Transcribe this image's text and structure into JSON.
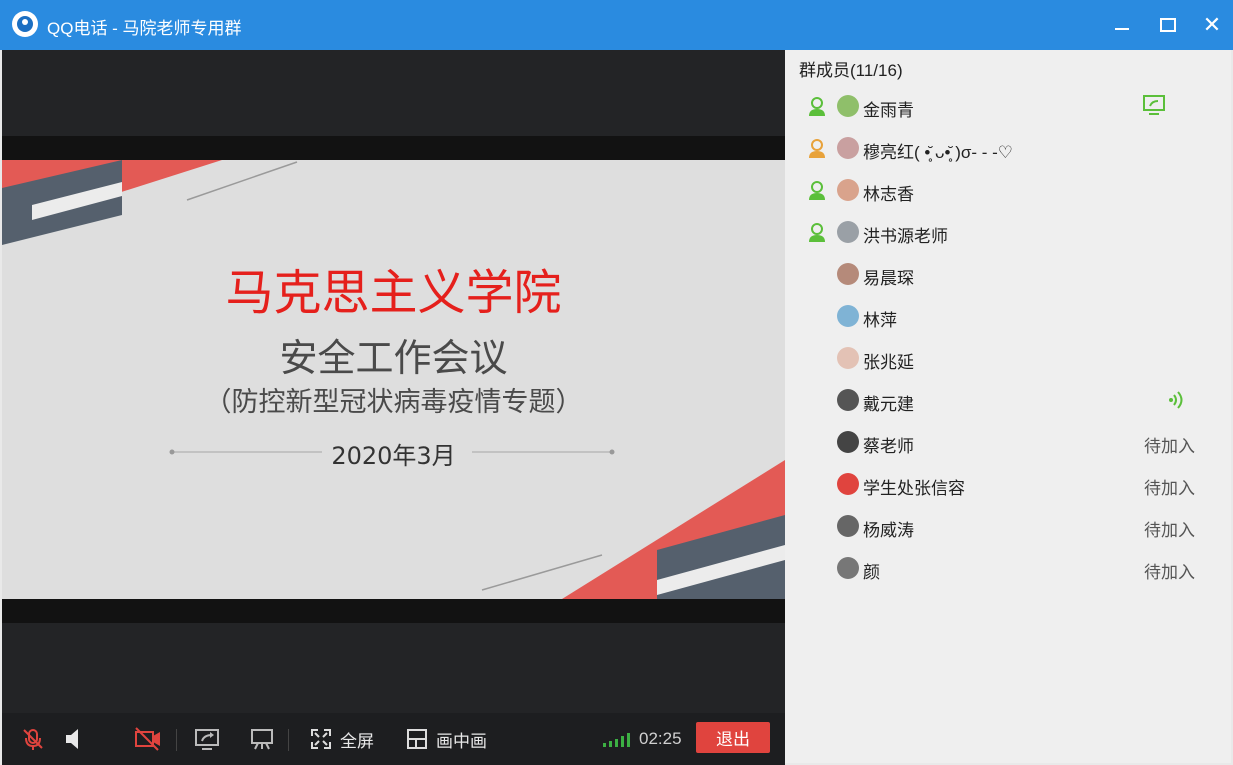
{
  "window": {
    "title": "QQ电话 - 马院老师专用群"
  },
  "slide": {
    "title": "马克思主义学院",
    "subtitle": "安全工作会议",
    "topic": "（防控新型冠状病毒疫情专题）",
    "date": "2020年3月"
  },
  "toolbar": {
    "fullscreen_label": "全屏",
    "pip_label": "画中画",
    "call_time": "02:25",
    "exit_label": "退出"
  },
  "panel": {
    "header": "群成员(11/16)",
    "members": [
      {
        "name": "金雨青",
        "status": "",
        "role": "green-user-icon",
        "extra": "screen-share-icon"
      },
      {
        "name": "穆亮红( •̥̆ ᴗ•̥̆ )σ- - -♡",
        "status": "",
        "role": "orange-user-icon",
        "extra": ""
      },
      {
        "name": "林志香",
        "status": "",
        "role": "green-user-icon",
        "extra": ""
      },
      {
        "name": "洪书源老师",
        "status": "",
        "role": "green-user-icon",
        "extra": ""
      },
      {
        "name": "易晨琛",
        "status": "",
        "role": "",
        "extra": ""
      },
      {
        "name": "林萍",
        "status": "",
        "role": "",
        "extra": ""
      },
      {
        "name": "张兆延",
        "status": "",
        "role": "",
        "extra": ""
      },
      {
        "name": "戴元建",
        "status": "",
        "role": "",
        "extra": "speaking-icon"
      },
      {
        "name": "蔡老师",
        "status": "待加入",
        "role": "",
        "extra": ""
      },
      {
        "name": "学生处张信容",
        "status": "待加入",
        "role": "",
        "extra": ""
      },
      {
        "name": "杨威涛",
        "status": "待加入",
        "role": "",
        "extra": ""
      },
      {
        "name": "颜",
        "status": "待加入",
        "role": "",
        "extra": ""
      }
    ]
  },
  "colors": {
    "titlebar": "#2a8be0",
    "exit": "#e0443e",
    "accent_red": "#e5201c",
    "online_green": "#5bbf3a"
  }
}
